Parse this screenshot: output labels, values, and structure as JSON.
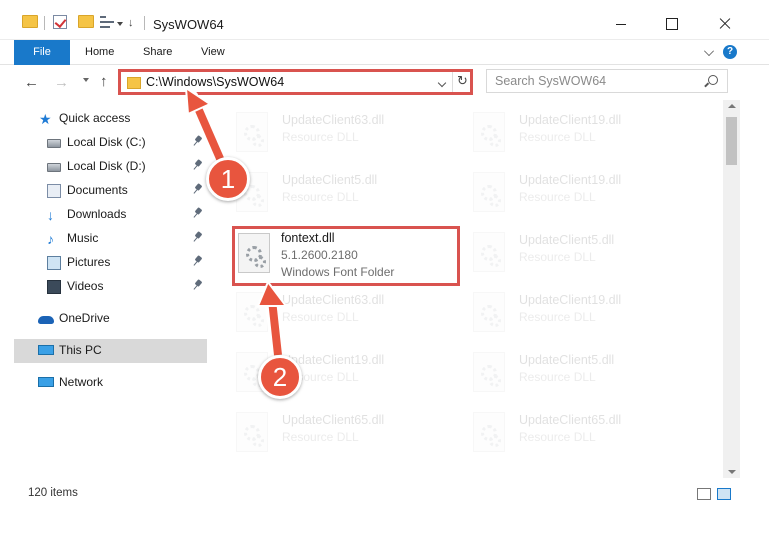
{
  "window": {
    "title": "SysWOW64"
  },
  "ribbon": {
    "file_label": "File",
    "tabs": [
      "Home",
      "Share",
      "View"
    ],
    "help_label": "?"
  },
  "nav": {
    "address": "C:\\Windows\\SysWOW64",
    "search_placeholder": "Search SysWOW64"
  },
  "sidebar": {
    "items": [
      {
        "label": "Quick access",
        "icon": "star-icon",
        "pinned": false
      },
      {
        "label": "Local Disk (C:)",
        "icon": "drive-icon",
        "pinned": true
      },
      {
        "label": "Local Disk (D:)",
        "icon": "drive-icon",
        "pinned": true
      },
      {
        "label": "Documents",
        "icon": "documents-icon",
        "pinned": true
      },
      {
        "label": "Downloads",
        "icon": "download-icon",
        "pinned": true
      },
      {
        "label": "Music",
        "icon": "music-icon",
        "pinned": true
      },
      {
        "label": "Pictures",
        "icon": "pictures-icon",
        "pinned": true
      },
      {
        "label": "Videos",
        "icon": "videos-icon",
        "pinned": true
      },
      {
        "label": "OneDrive",
        "icon": "onedrive-icon",
        "pinned": false
      },
      {
        "label": "This PC",
        "icon": "computer-icon",
        "pinned": false,
        "selected": true
      },
      {
        "label": "Network",
        "icon": "network-icon",
        "pinned": false
      }
    ]
  },
  "files": [
    {
      "name": "UpdateClient63.dll",
      "desc": "Resource DLL"
    },
    {
      "name": "UpdateClient19.dll",
      "desc": "Resource DLL"
    },
    {
      "name": "UpdateClient5.dll",
      "desc": "Resource DLL"
    },
    {
      "name": "UpdateClient19.dll",
      "desc": "Resource DLL"
    },
    {
      "name": "fontext.dll",
      "version": "5.1.2600.2180",
      "desc": "Windows Font Folder"
    },
    {
      "name": "UpdateClient5.dll",
      "desc": "Resource DLL"
    },
    {
      "name": "UpdateClient63.dll",
      "desc": "Resource DLL"
    },
    {
      "name": "UpdateClient19.dll",
      "desc": "Resource DLL"
    },
    {
      "name": "UpdateClient19.dll",
      "desc": "Resource DLL"
    },
    {
      "name": "UpdateClient5.dll",
      "desc": "Resource DLL"
    },
    {
      "name": "UpdateClient65.dll",
      "desc": "Resource DLL"
    },
    {
      "name": "UpdateClient65.dll",
      "desc": "Resource DLL"
    }
  ],
  "status": {
    "item_count": "120 items"
  },
  "annotations": {
    "step1": "1",
    "step2": "2"
  },
  "colors": {
    "accent": "#1979ca",
    "annotation_red": "#d9534f",
    "badge": "#e8553e"
  }
}
